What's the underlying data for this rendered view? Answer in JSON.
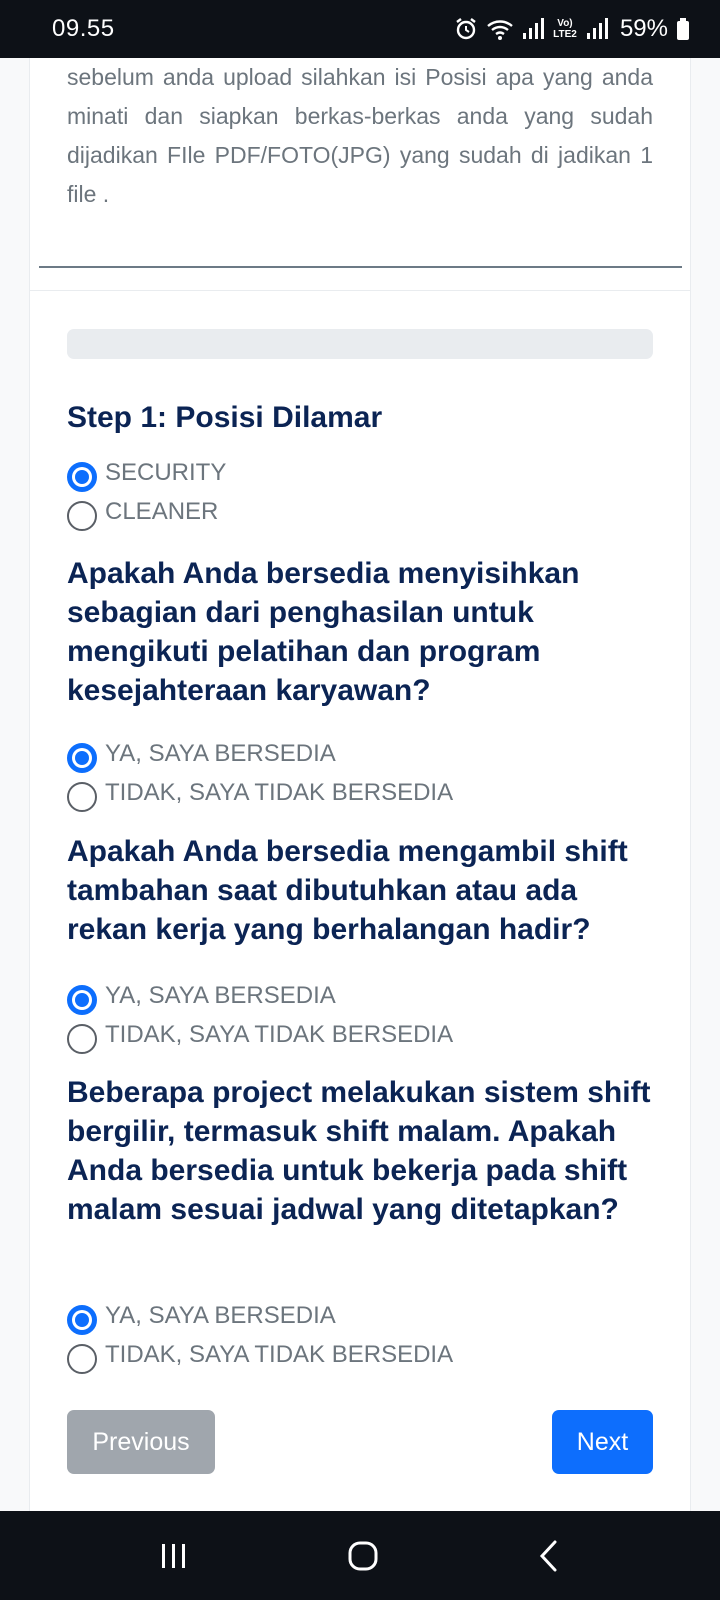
{
  "status_bar": {
    "time": "09.55",
    "network_label": "Vo) LTE2",
    "battery": "59%"
  },
  "intro_text": "sebelum anda upload silahkan isi Posisi apa yang anda minati dan siapkan berkas-berkas anda yang sudah dijadikan FIle PDF/FOTO(JPG) yang sudah di jadikan 1 file .",
  "step_title": "Step 1: Posisi Dilamar",
  "position_options": [
    {
      "label": "SECURITY",
      "checked": true
    },
    {
      "label": "CLEANER",
      "checked": false
    }
  ],
  "questions": [
    {
      "text": "Apakah Anda bersedia menyisihkan sebagian dari penghasilan untuk mengikuti pelatihan dan program kesejahteraan karyawan?",
      "options": [
        {
          "label": "YA, SAYA BERSEDIA",
          "checked": true
        },
        {
          "label": "TIDAK, SAYA TIDAK BERSEDIA",
          "checked": false
        }
      ]
    },
    {
      "text": "Apakah Anda bersedia mengambil shift tambahan saat dibutuhkan atau ada rekan kerja yang berhalangan hadir?",
      "options": [
        {
          "label": "YA, SAYA BERSEDIA",
          "checked": true
        },
        {
          "label": "TIDAK, SAYA TIDAK BERSEDIA",
          "checked": false
        }
      ]
    },
    {
      "text": "Beberapa project melakukan sistem shift bergilir, termasuk shift malam. Apakah Anda bersedia untuk bekerja pada shift malam sesuai jadwal yang ditetapkan?",
      "options": [
        {
          "label": "YA, SAYA BERSEDIA",
          "checked": true
        },
        {
          "label": "TIDAK, SAYA TIDAK BERSEDIA",
          "checked": false
        }
      ]
    }
  ],
  "buttons": {
    "previous": "Previous",
    "next": "Next"
  },
  "colors": {
    "primary": "#0d6efd",
    "heading": "#0b2454",
    "muted_text": "#6c757d",
    "secondary_button": "#a0a6ad",
    "system_bar": "#0d1117"
  },
  "icons": {
    "status": [
      "alarm-icon",
      "wifi-icon",
      "signal-icon",
      "signal-icon-2",
      "battery-icon"
    ],
    "nav": [
      "recent-apps-icon",
      "home-icon",
      "back-icon"
    ]
  }
}
